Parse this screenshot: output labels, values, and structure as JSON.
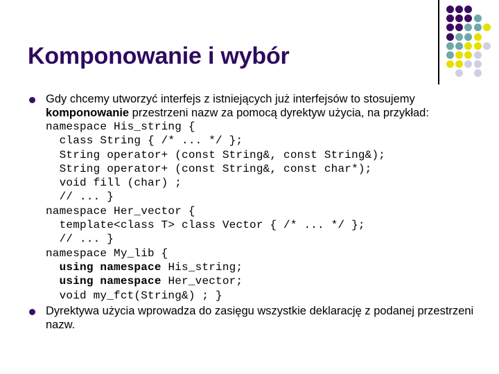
{
  "slide": {
    "title": "Komponowanie i wybór",
    "title_color": "#2D0A5E",
    "bullet_color": "#36106B",
    "background_color": "#FFFFFF"
  },
  "decoration": {
    "rule_color": "#000000",
    "palette": {
      "purple": "#3B0B62",
      "teal": "#6FA8A8",
      "yellow": "#E6E000",
      "lavender": "#CFCFE4"
    },
    "dot_grid": [
      [
        "purple",
        "purple",
        "purple",
        "",
        ""
      ],
      [
        "purple",
        "purple",
        "purple",
        "teal",
        ""
      ],
      [
        "purple",
        "purple",
        "teal",
        "teal",
        "yellow"
      ],
      [
        "purple",
        "teal",
        "teal",
        "yellow",
        ""
      ],
      [
        "teal",
        "teal",
        "yellow",
        "yellow",
        "lavender"
      ],
      [
        "teal",
        "yellow",
        "yellow",
        "lavender",
        ""
      ],
      [
        "yellow",
        "yellow",
        "lavender",
        "lavender",
        ""
      ],
      [
        "",
        "lavender",
        "",
        "lavender",
        ""
      ]
    ]
  },
  "bullets": {
    "first": {
      "part1": "Gdy chcemy utworzyć interfejs z istniejących już interfejsów to stosujemy ",
      "emphasis": "komponowanie",
      "part2": " przestrzeni nazw za pomocą dyrektyw użycia, na przykład:"
    },
    "second": {
      "text": "Dyrektywa użycia wprowadza do zasięgu wszystkie deklarację z podanej przestrzeni nazw."
    }
  },
  "code": {
    "seg1": "namespace His_string {\n  class String { /* ... */ };\n  String operator+ (const String&, const String&);\n  String operator+ (const String&, const char*);\n  void fill (char) ;\n  // ... }\nnamespace Her_vector {\n  template<class T> class Vector { /* ... */ };\n  // ... }\nnamespace My_lib {\n  ",
    "kw1": "using namespace",
    "seg2": " His_string;\n  ",
    "kw2": "using namespace",
    "seg3": " Her_vector;\n  void my_fct(String&) ; }"
  }
}
